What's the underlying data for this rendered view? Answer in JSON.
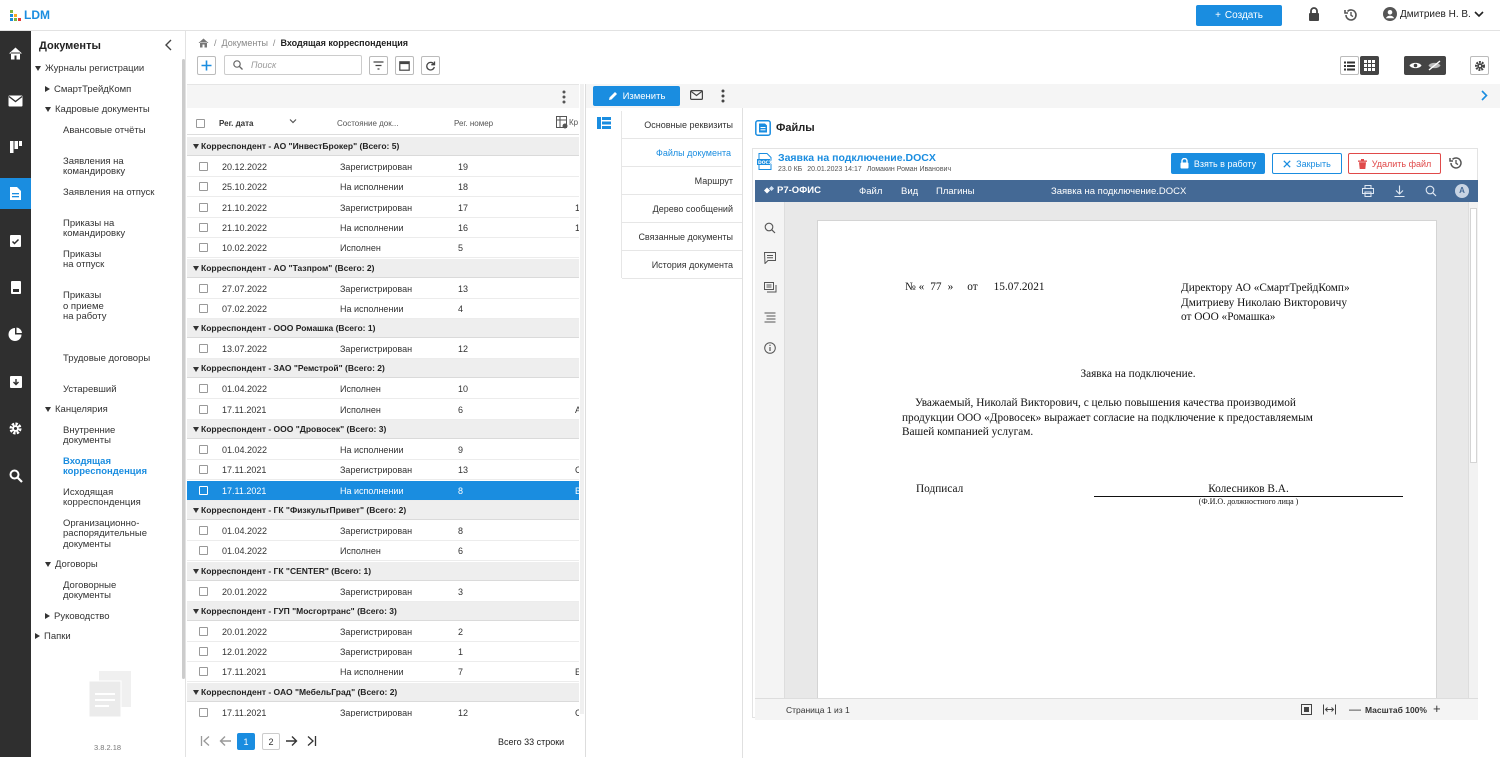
{
  "app": {
    "logo": "LDM",
    "create_label": "Создать",
    "user_name": "Дмитриев Н. В.",
    "accent": "#1a8de0"
  },
  "nav": {
    "title": "Документы",
    "items": [
      {
        "label": "Журналы регистрации",
        "level": 0,
        "arrow": "down"
      },
      {
        "label": "СмартТрейдКомп",
        "level": 1,
        "arrow": "right"
      },
      {
        "label": "Кадровые документы",
        "level": 1,
        "arrow": "down"
      },
      {
        "label": "Авансовые отчёты",
        "level": 2
      },
      {
        "label": "Заявления на командировку",
        "level": 2
      },
      {
        "label": "Заявления на отпуск",
        "level": 2
      },
      {
        "label": "Приказы на командировку",
        "level": 2
      },
      {
        "label": "Приказы на отпуск",
        "level": 2
      },
      {
        "label": "Приказы о приеме на работу",
        "level": 2
      },
      {
        "label": "Трудовые договоры",
        "level": 2
      },
      {
        "label": "Устаревший",
        "level": 2
      },
      {
        "label": "Канцелярия",
        "level": 1,
        "arrow": "down"
      },
      {
        "label": "Внутренние документы",
        "level": 2
      },
      {
        "label": "Входящая корреспонденция",
        "level": 2,
        "selected": true
      },
      {
        "label": "Исходящая корреспонденция",
        "level": 2
      },
      {
        "label": "Организационно-распорядительные документы",
        "level": 2
      },
      {
        "label": "Договоры",
        "level": 1,
        "arrow": "down"
      },
      {
        "label": "Договорные документы",
        "level": 2
      },
      {
        "label": "Руководство",
        "level": 1,
        "arrow": "right"
      },
      {
        "label": "Папки",
        "level": 0,
        "arrow": "right"
      }
    ],
    "version": "3.8.2.18"
  },
  "breadcrumb": {
    "home": "home-icon",
    "parent": "Документы",
    "current": "Входящая корреспонденция"
  },
  "search": {
    "placeholder": "Поиск"
  },
  "table": {
    "columns": [
      "Рег. дата",
      "Состояние док...",
      "Рег. номер",
      "Кр"
    ],
    "groups": [
      {
        "title": "Корреспондент - АО \"ИнвестБрокер\" (Всего: 5)",
        "rows": [
          {
            "date": "20.12.2022",
            "status": "Зарегистрирован",
            "num": "19",
            "extra": ""
          },
          {
            "date": "25.10.2022",
            "status": "На исполнении",
            "num": "18",
            "extra": ""
          },
          {
            "date": "21.10.2022",
            "status": "Зарегистрирован",
            "num": "17",
            "extra": "1"
          },
          {
            "date": "21.10.2022",
            "status": "На исполнении",
            "num": "16",
            "extra": "1"
          },
          {
            "date": "10.02.2022",
            "status": "Исполнен",
            "num": "5",
            "extra": ""
          }
        ]
      },
      {
        "title": "Корреспондент - АО \"Тазпром\" (Всего: 2)",
        "rows": [
          {
            "date": "27.07.2022",
            "status": "Зарегистрирован",
            "num": "13",
            "extra": ""
          },
          {
            "date": "07.02.2022",
            "status": "На исполнении",
            "num": "4",
            "extra": ""
          }
        ]
      },
      {
        "title": "Корреспондент - ООО Ромашка (Всего: 1)",
        "rows": [
          {
            "date": "13.07.2022",
            "status": "Зарегистрирован",
            "num": "12",
            "extra": ""
          }
        ]
      },
      {
        "title": "Корреспондент - ЗАО \"Ремстрой\" (Всего: 2)",
        "rows": [
          {
            "date": "01.04.2022",
            "status": "Исполнен",
            "num": "10",
            "extra": ""
          },
          {
            "date": "17.11.2021",
            "status": "Исполнен",
            "num": "6",
            "extra": "А"
          }
        ]
      },
      {
        "title": "Корреспондент - ООО \"Дровосек\" (Всего: 3)",
        "rows": [
          {
            "date": "01.04.2022",
            "status": "На исполнении",
            "num": "9",
            "extra": ""
          },
          {
            "date": "17.11.2021",
            "status": "Зарегистрирован",
            "num": "13",
            "extra": "С"
          },
          {
            "date": "17.11.2021",
            "status": "На исполнении",
            "num": "8",
            "extra": "В",
            "selected": true
          }
        ]
      },
      {
        "title": "Корреспондент - ГК \"ФизкультПривет\" (Всего: 2)",
        "rows": [
          {
            "date": "01.04.2022",
            "status": "Зарегистрирован",
            "num": "8",
            "extra": ""
          },
          {
            "date": "01.04.2022",
            "status": "Исполнен",
            "num": "6",
            "extra": ""
          }
        ]
      },
      {
        "title": "Корреспондент - ГК \"CENTER\" (Всего: 1)",
        "rows": [
          {
            "date": "20.01.2022",
            "status": "Зарегистрирован",
            "num": "3",
            "extra": ""
          }
        ]
      },
      {
        "title": "Корреспондент - ГУП \"Мосгортранс\" (Всего: 3)",
        "rows": [
          {
            "date": "20.01.2022",
            "status": "Зарегистрирован",
            "num": "2",
            "extra": ""
          },
          {
            "date": "12.01.2022",
            "status": "Зарегистрирован",
            "num": "1",
            "extra": ""
          },
          {
            "date": "17.11.2021",
            "status": "На исполнении",
            "num": "7",
            "extra": "Е"
          }
        ]
      },
      {
        "title": "Корреспондент - ОАО \"МебельГрад\" (Всего: 2)",
        "rows": [
          {
            "date": "17.11.2021",
            "status": "Зарегистрирован",
            "num": "12",
            "extra": "С"
          }
        ]
      }
    ]
  },
  "pager": {
    "pages": [
      "1",
      "2"
    ],
    "current": "1",
    "total": "Всего 33 строки"
  },
  "detail": {
    "edit_label": "Изменить",
    "tabs": [
      "Основные реквизиты",
      "Файлы документа",
      "Маршрут",
      "Дерево сообщений",
      "Связанные документы",
      "История документа"
    ],
    "active_tab": 1
  },
  "files": {
    "title": "Файлы",
    "file_name": "Заявка на подключение.DOCX",
    "file_size": "23.0 КБ",
    "file_date": "20.01.2023 14:17",
    "file_author": "Ломакин Роман Иванович",
    "take_label": "Взять в работу",
    "close_label": "Закрыть",
    "delete_label": "Удалить файл"
  },
  "editor": {
    "brand": "Р7-ОФИС",
    "menu": [
      "Файл",
      "Вид",
      "Плагины"
    ],
    "doc_name": "Заявка на подключение.DOCX",
    "page_status": "Страница 1 из 1",
    "zoom": "Масштаб 100%",
    "avatar_letter": "А"
  },
  "letter": {
    "number_label": "№ «",
    "number": "77",
    "number_close": "»",
    "from_label": "от",
    "date": "15.07.2021",
    "addressee": [
      "Директору АО «СмартТрейдКомп»",
      "Дмитриеву Николаю Викторовичу",
      "от ООО «Ромашка»"
    ],
    "heading": "Заявка на подключение.",
    "body": [
      "Уважаемый, Николай Викторович, с целью повышения качества производимой",
      "продукции ООО «Дровосек» выражает согласие на подключение к предоставляемым",
      "Вашей компанией услугам."
    ],
    "signed_label": "Подписал",
    "signer": "Колесников В.А.",
    "signer_caption": "(Ф.И.О. должностного лица )"
  }
}
